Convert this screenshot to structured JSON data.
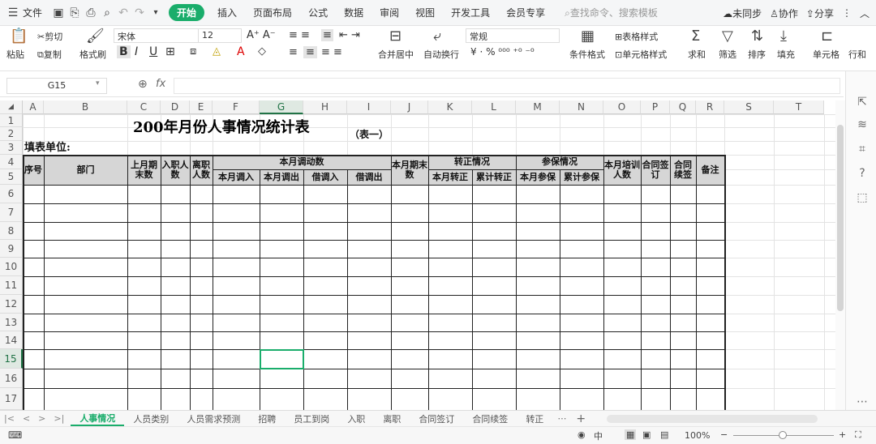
{
  "menu": {
    "file_label": "文件",
    "tabs": [
      "开始",
      "插入",
      "页面布局",
      "公式",
      "数据",
      "审阅",
      "视图",
      "开发工具",
      "会员专享"
    ],
    "search_placeholder": "查找命令、搜索模板",
    "sync_label": "未同步",
    "collab_label": "协作",
    "share_label": "分享"
  },
  "toolbar": {
    "paste": "粘贴",
    "cut": "剪切",
    "copy": "复制",
    "format_painter": "格式刷",
    "font_name": "宋体",
    "font_size": "12",
    "merge_center": "合并居中",
    "wrap_text": "自动换行",
    "number_format": "常规",
    "conditional_format": "条件格式",
    "table_style": "表格样式",
    "cell_style": "单元格样式",
    "sum": "求和",
    "filter": "筛选",
    "sort": "排序",
    "fill": "填充",
    "cell": "单元格",
    "row_col": "行和"
  },
  "formula_bar": {
    "cell_ref": "G15",
    "fx": "fx",
    "value": ""
  },
  "grid": {
    "columns": [
      "A",
      "B",
      "C",
      "D",
      "E",
      "F",
      "G",
      "H",
      "I",
      "J",
      "K",
      "L",
      "M",
      "N",
      "O",
      "P",
      "Q",
      "R",
      "S",
      "T"
    ],
    "rows": [
      "1",
      "2",
      "3",
      "4",
      "5",
      "6",
      "7",
      "8",
      "9",
      "10",
      "11",
      "12",
      "13",
      "14",
      "15",
      "16",
      "17"
    ],
    "selected_col": "G",
    "selected_row": "15"
  },
  "sheet": {
    "title": "200年月份人事情况统计表",
    "subtitle": "（表一）",
    "unit_label": "填表单位:",
    "headers": {
      "seq": "序号",
      "dept": "部门",
      "last_month_end": "上月期末数",
      "join": "入职人数",
      "leave": "离职人数",
      "transfer_group": "本月调动数",
      "transfer_in": "本月调入",
      "transfer_out": "本月调出",
      "borrow_in": "借调入",
      "borrow_out": "借调出",
      "month_end": "本月期末数",
      "regular_group": "转正情况",
      "regular_month": "本月转正",
      "regular_total": "累计转正",
      "insurance_group": "参保情况",
      "insurance_month": "本月参保",
      "insurance_total": "累计参保",
      "training": "本月培训人数",
      "contract_sign": "合同签订",
      "contract_renew": "合同续签",
      "remark": "备注"
    }
  },
  "sheet_tabs": [
    "人事情况",
    "人员类别",
    "人员需求预测",
    "招聘",
    "员工到岗",
    "入职",
    "离职",
    "合同签订",
    "合同续签",
    "转正"
  ],
  "status": {
    "zoom": "100%"
  },
  "colors": {
    "accent": "#1aad6b",
    "header_fill": "#d6d6d6"
  }
}
